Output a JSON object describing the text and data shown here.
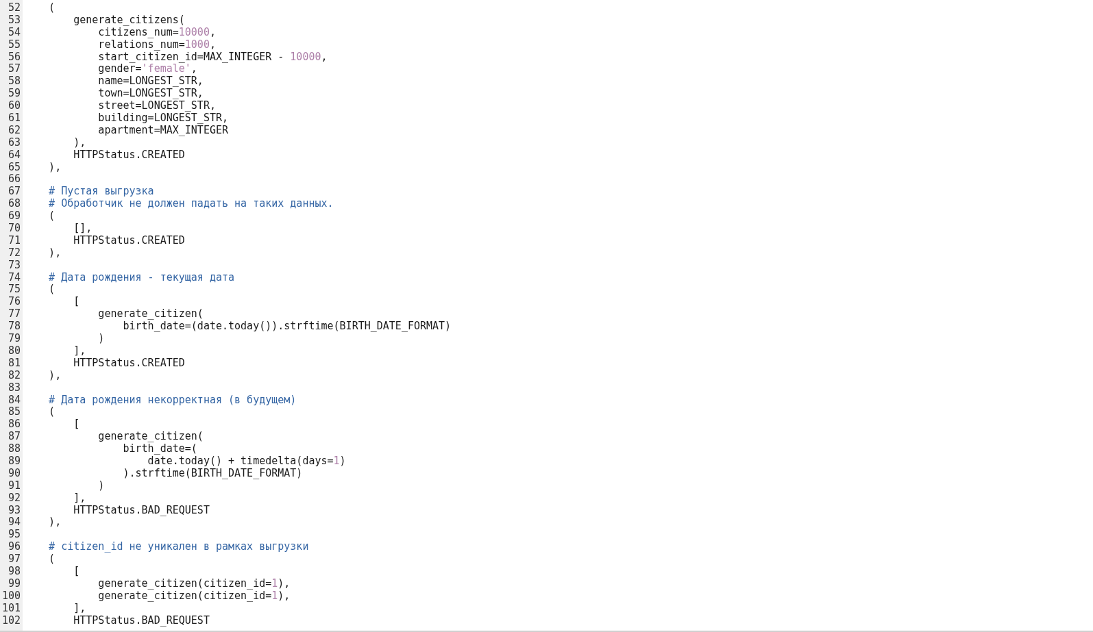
{
  "editor": {
    "lines": [
      {
        "number": "52",
        "segments": [
          {
            "kind": "plain",
            "text": "    ("
          }
        ]
      },
      {
        "number": "53",
        "segments": [
          {
            "kind": "plain",
            "text": "        generate_citizens("
          }
        ]
      },
      {
        "number": "54",
        "segments": [
          {
            "kind": "plain",
            "text": "            citizens_num="
          },
          {
            "kind": "number",
            "text": "10000"
          },
          {
            "kind": "plain",
            "text": ","
          }
        ]
      },
      {
        "number": "55",
        "segments": [
          {
            "kind": "plain",
            "text": "            relations_num="
          },
          {
            "kind": "number",
            "text": "1000"
          },
          {
            "kind": "plain",
            "text": ","
          }
        ]
      },
      {
        "number": "56",
        "segments": [
          {
            "kind": "plain",
            "text": "            start_citizen_id=MAX_INTEGER - "
          },
          {
            "kind": "number",
            "text": "10000"
          },
          {
            "kind": "plain",
            "text": ","
          }
        ]
      },
      {
        "number": "57",
        "segments": [
          {
            "kind": "plain",
            "text": "            gender="
          },
          {
            "kind": "string",
            "text": "'female'"
          },
          {
            "kind": "plain",
            "text": ","
          }
        ]
      },
      {
        "number": "58",
        "segments": [
          {
            "kind": "plain",
            "text": "            name=LONGEST_STR,"
          }
        ]
      },
      {
        "number": "59",
        "segments": [
          {
            "kind": "plain",
            "text": "            town=LONGEST_STR,"
          }
        ]
      },
      {
        "number": "60",
        "segments": [
          {
            "kind": "plain",
            "text": "            street=LONGEST_STR,"
          }
        ]
      },
      {
        "number": "61",
        "segments": [
          {
            "kind": "plain",
            "text": "            building=LONGEST_STR,"
          }
        ]
      },
      {
        "number": "62",
        "segments": [
          {
            "kind": "plain",
            "text": "            apartment=MAX_INTEGER"
          }
        ]
      },
      {
        "number": "63",
        "segments": [
          {
            "kind": "plain",
            "text": "        ),"
          }
        ]
      },
      {
        "number": "64",
        "segments": [
          {
            "kind": "plain",
            "text": "        HTTPStatus.CREATED"
          }
        ]
      },
      {
        "number": "65",
        "segments": [
          {
            "kind": "plain",
            "text": "    ),"
          }
        ]
      },
      {
        "number": "66"
      },
      {
        "number": "67",
        "segments": [
          {
            "kind": "comment",
            "text": "    # Пустая выгрузка"
          }
        ]
      },
      {
        "number": "68",
        "segments": [
          {
            "kind": "comment",
            "text": "    # Обработчик не должен падать на таких данных."
          }
        ]
      },
      {
        "number": "69",
        "segments": [
          {
            "kind": "plain",
            "text": "    ("
          }
        ]
      },
      {
        "number": "70",
        "segments": [
          {
            "kind": "plain",
            "text": "        [],"
          }
        ]
      },
      {
        "number": "71",
        "segments": [
          {
            "kind": "plain",
            "text": "        HTTPStatus.CREATED"
          }
        ]
      },
      {
        "number": "72",
        "segments": [
          {
            "kind": "plain",
            "text": "    ),"
          }
        ]
      },
      {
        "number": "73"
      },
      {
        "number": "74",
        "segments": [
          {
            "kind": "comment",
            "text": "    # Дата рождения - текущая дата"
          }
        ]
      },
      {
        "number": "75",
        "segments": [
          {
            "kind": "plain",
            "text": "    ("
          }
        ]
      },
      {
        "number": "76",
        "segments": [
          {
            "kind": "plain",
            "text": "        ["
          }
        ]
      },
      {
        "number": "77",
        "segments": [
          {
            "kind": "plain",
            "text": "            generate_citizen("
          }
        ]
      },
      {
        "number": "78",
        "segments": [
          {
            "kind": "plain",
            "text": "                birth_date=(date.today()).strftime(BIRTH_DATE_FORMAT)"
          }
        ]
      },
      {
        "number": "79",
        "segments": [
          {
            "kind": "plain",
            "text": "            )"
          }
        ]
      },
      {
        "number": "80",
        "segments": [
          {
            "kind": "plain",
            "text": "        ],"
          }
        ]
      },
      {
        "number": "81",
        "segments": [
          {
            "kind": "plain",
            "text": "        HTTPStatus.CREATED"
          }
        ]
      },
      {
        "number": "82",
        "segments": [
          {
            "kind": "plain",
            "text": "    ),"
          }
        ]
      },
      {
        "number": "83"
      },
      {
        "number": "84",
        "segments": [
          {
            "kind": "comment",
            "text": "    # Дата рождения некорректная (в будущем)"
          }
        ]
      },
      {
        "number": "85",
        "segments": [
          {
            "kind": "plain",
            "text": "    ("
          }
        ]
      },
      {
        "number": "86",
        "segments": [
          {
            "kind": "plain",
            "text": "        ["
          }
        ]
      },
      {
        "number": "87",
        "segments": [
          {
            "kind": "plain",
            "text": "            generate_citizen("
          }
        ]
      },
      {
        "number": "88",
        "segments": [
          {
            "kind": "plain",
            "text": "                birth_date=("
          }
        ]
      },
      {
        "number": "89",
        "segments": [
          {
            "kind": "plain",
            "text": "                    date.today() + timedelta(days="
          },
          {
            "kind": "number",
            "text": "1"
          },
          {
            "kind": "plain",
            "text": ")"
          }
        ]
      },
      {
        "number": "90",
        "segments": [
          {
            "kind": "plain",
            "text": "                ).strftime(BIRTH_DATE_FORMAT)"
          }
        ]
      },
      {
        "number": "91",
        "segments": [
          {
            "kind": "plain",
            "text": "            )"
          }
        ]
      },
      {
        "number": "92",
        "segments": [
          {
            "kind": "plain",
            "text": "        ],"
          }
        ]
      },
      {
        "number": "93",
        "segments": [
          {
            "kind": "plain",
            "text": "        HTTPStatus.BAD_REQUEST"
          }
        ]
      },
      {
        "number": "94",
        "segments": [
          {
            "kind": "plain",
            "text": "    ),"
          }
        ]
      },
      {
        "number": "95"
      },
      {
        "number": "96",
        "segments": [
          {
            "kind": "comment",
            "text": "    # citizen_id не уникален в рамках выгрузки"
          }
        ]
      },
      {
        "number": "97",
        "segments": [
          {
            "kind": "plain",
            "text": "    ("
          }
        ]
      },
      {
        "number": "98",
        "segments": [
          {
            "kind": "plain",
            "text": "        ["
          }
        ]
      },
      {
        "number": "99",
        "segments": [
          {
            "kind": "plain",
            "text": "            generate_citizen(citizen_id="
          },
          {
            "kind": "number",
            "text": "1"
          },
          {
            "kind": "plain",
            "text": "),"
          }
        ]
      },
      {
        "number": "100",
        "segments": [
          {
            "kind": "plain",
            "text": "            generate_citizen(citizen_id="
          },
          {
            "kind": "number",
            "text": "1"
          },
          {
            "kind": "plain",
            "text": "),"
          }
        ]
      },
      {
        "number": "101",
        "segments": [
          {
            "kind": "plain",
            "text": "        ],"
          }
        ]
      },
      {
        "number": "102",
        "segments": [
          {
            "kind": "plain",
            "text": "        HTTPStatus.BAD_REQUEST"
          }
        ]
      }
    ]
  }
}
